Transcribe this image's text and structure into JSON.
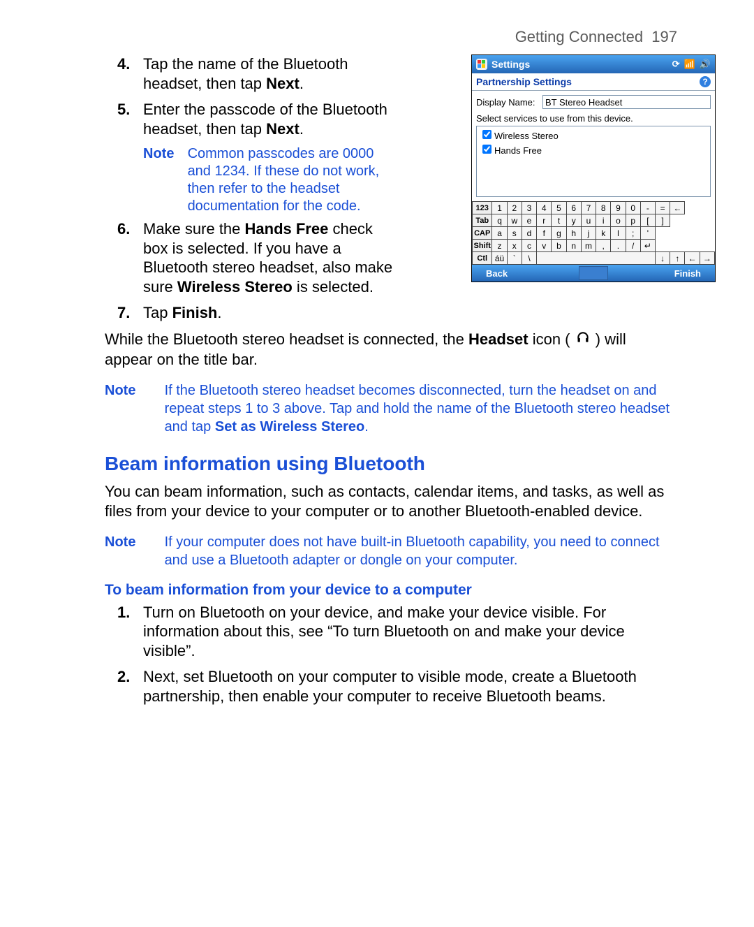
{
  "header": {
    "title": "Getting Connected",
    "page": "197"
  },
  "steps_a": [
    {
      "num": "4.",
      "html": "Tap the name of the Bluetooth headset, then tap <b>Next</b>."
    },
    {
      "num": "5.",
      "html": "Enter the passcode of the Bluetooth headset, then tap <b>Next</b>."
    }
  ],
  "note1": {
    "label": "Note",
    "text": "Common passcodes are 0000 and 1234. If these do not work, then refer to the headset documentation for the code."
  },
  "steps_b": [
    {
      "num": "6.",
      "html": "Make sure the <b>Hands Free</b> check box is selected. If you have a Bluetooth stereo headset, also make sure <b>Wireless Stereo</b> is selected."
    },
    {
      "num": "7.",
      "html": "Tap <b>Finish</b>."
    }
  ],
  "para1_pre": "While the Bluetooth stereo headset is connected, the ",
  "para1_bold": "Headset",
  "para1_mid": " icon ( ",
  "para1_post": " ) will appear on the title bar.",
  "note2": {
    "label": "Note",
    "html": "If the Bluetooth stereo headset becomes disconnected, turn the headset on and repeat steps 1 to 3 above. Tap and hold the name of the Bluetooth stereo headset and tap <b>Set as Wireless Stereo</b>."
  },
  "section": "Beam information using Bluetooth",
  "para2": "You can beam information, such as contacts, calendar items, and tasks, as well as files from your device to your computer or to another Bluetooth-enabled device.",
  "note3": {
    "label": "Note",
    "text": "If your computer does not have built-in Bluetooth capability, you need to connect and use a Bluetooth adapter or dongle on your computer."
  },
  "subsection": "To beam information from your device to a computer",
  "steps_c": [
    {
      "num": "1.",
      "html": "Turn on Bluetooth on your device, and make your device visible. For information about this, see “To turn Bluetooth on and make your device visible”."
    },
    {
      "num": "2.",
      "html": "Next, set Bluetooth on your computer to visible mode, create a Bluetooth partnership, then enable your computer to receive Bluetooth beams."
    }
  ],
  "device": {
    "titlebar": "Settings",
    "subheader": "Partnership Settings",
    "display_label": "Display Name:",
    "display_value": "BT Stereo Headset",
    "select_text": "Select services to use from this device.",
    "services": [
      "Wireless Stereo",
      "Hands Free"
    ],
    "kb": {
      "r1": [
        "123",
        "1",
        "2",
        "3",
        "4",
        "5",
        "6",
        "7",
        "8",
        "9",
        "0",
        "-",
        "=",
        "←"
      ],
      "r2": [
        "Tab",
        "q",
        "w",
        "e",
        "r",
        "t",
        "y",
        "u",
        "i",
        "o",
        "p",
        "[",
        "]"
      ],
      "r3": [
        "CAP",
        "a",
        "s",
        "d",
        "f",
        "g",
        "h",
        "j",
        "k",
        "l",
        ";",
        "'"
      ],
      "r4": [
        "Shift",
        "z",
        "x",
        "c",
        "v",
        "b",
        "n",
        "m",
        ",",
        ".",
        "/",
        "↵"
      ],
      "r5": [
        "Ctl",
        "áü",
        "`",
        "\\",
        " ",
        "↓",
        "↑",
        "←",
        "→"
      ]
    },
    "back": "Back",
    "finish": "Finish"
  }
}
